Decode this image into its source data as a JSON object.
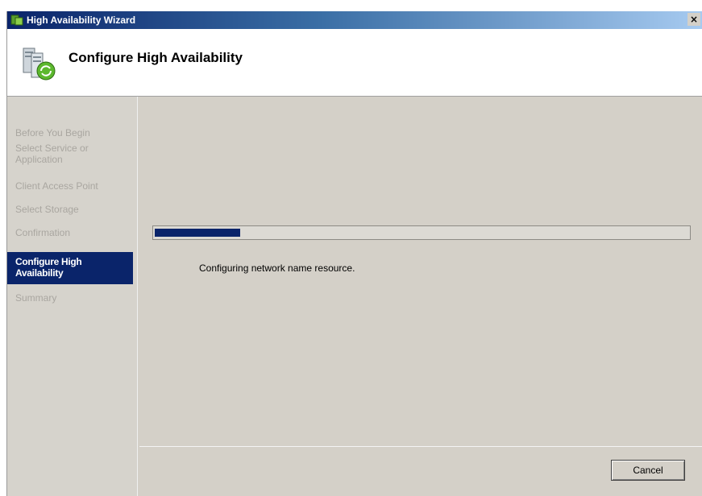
{
  "window": {
    "title": "High Availability Wizard",
    "close_glyph": "×",
    "app_icon": "wizard-app-icon"
  },
  "header": {
    "heading": "Configure High Availability",
    "icon": "server-cluster-icon"
  },
  "nav": {
    "items": [
      {
        "label": "Before You Begin",
        "active": false
      },
      {
        "label": "Select Service or Application",
        "active": false
      },
      {
        "label": "Client Access Point",
        "active": false
      },
      {
        "label": "Select Storage",
        "active": false
      },
      {
        "label": "Confirmation",
        "active": false
      },
      {
        "label": "Configure High Availability",
        "active": true
      },
      {
        "label": "Summary",
        "active": false
      }
    ]
  },
  "progress": {
    "fraction": 0.16,
    "status_text": "Configuring network name resource."
  },
  "buttons": {
    "cancel_label": "Cancel"
  },
  "colors": {
    "title_bar_start": "#0a246a",
    "selection": "#0a246a",
    "dialog_face": "#d4d0c8"
  }
}
